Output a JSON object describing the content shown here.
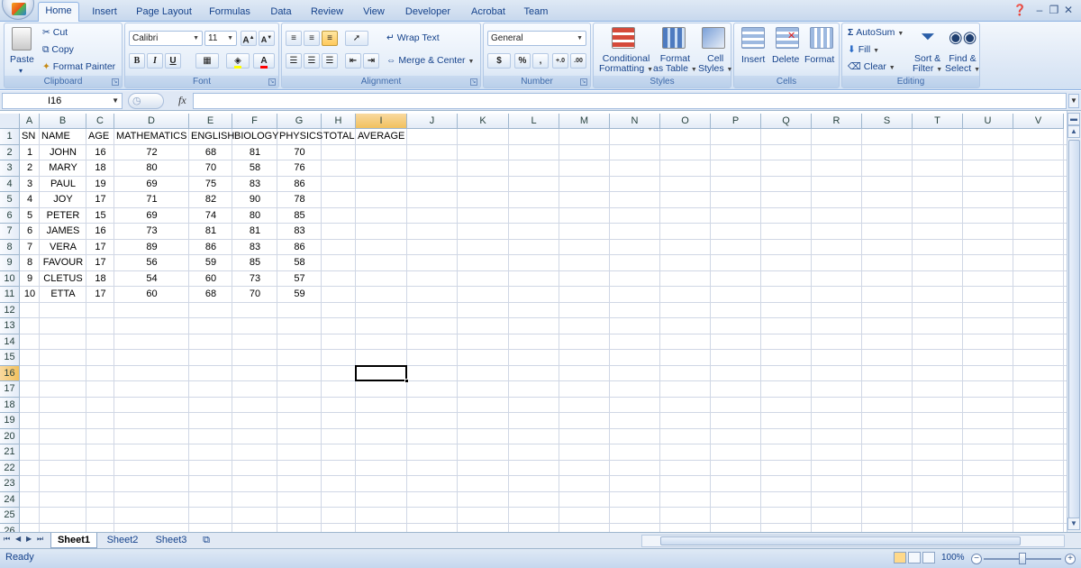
{
  "tabs": [
    "Home",
    "Insert",
    "Page Layout",
    "Formulas",
    "Data",
    "Review",
    "View",
    "Developer",
    "Acrobat",
    "Team"
  ],
  "active_tab": "Home",
  "ribbon": {
    "clipboard": {
      "label": "Clipboard",
      "paste": "Paste",
      "cut": "Cut",
      "copy": "Copy",
      "format_painter": "Format Painter"
    },
    "font": {
      "label": "Font",
      "font_name": "Calibri",
      "font_size": "11",
      "bold": "B",
      "italic": "I",
      "underline": "U"
    },
    "alignment": {
      "label": "Alignment",
      "wrap_text": "Wrap Text",
      "merge_center": "Merge & Center"
    },
    "number": {
      "label": "Number",
      "format": "General",
      "currency": "$",
      "percent": "%",
      "comma": ",",
      "inc_decimal": "+.0",
      "dec_decimal": ".00"
    },
    "styles": {
      "label": "Styles",
      "conditional_1": "Conditional",
      "conditional_2": "Formatting",
      "format_table_1": "Format",
      "format_table_2": "as Table",
      "cell_styles_1": "Cell",
      "cell_styles_2": "Styles"
    },
    "cells": {
      "label": "Cells",
      "insert": "Insert",
      "delete": "Delete",
      "format": "Format"
    },
    "editing": {
      "label": "Editing",
      "autosum": "AutoSum",
      "fill": "Fill",
      "clear": "Clear",
      "sort_1": "Sort &",
      "sort_2": "Filter",
      "find_1": "Find &",
      "find_2": "Select"
    }
  },
  "formula_bar": {
    "name_box": "I16",
    "fx": "fx",
    "formula": ""
  },
  "columns": [
    "A",
    "B",
    "C",
    "D",
    "E",
    "F",
    "G",
    "H",
    "I",
    "J",
    "K",
    "L",
    "M",
    "N",
    "O",
    "P",
    "Q",
    "R",
    "S",
    "T",
    "U",
    "V"
  ],
  "selected_column": "I",
  "rows": [
    "1",
    "2",
    "3",
    "4",
    "5",
    "6",
    "7",
    "8",
    "9",
    "10",
    "11",
    "12",
    "13",
    "14",
    "15",
    "16",
    "17",
    "18",
    "19",
    "20",
    "21",
    "22",
    "23",
    "24",
    "25",
    "26"
  ],
  "selected_row": "16",
  "sheet": {
    "headers": [
      "SN",
      "NAME",
      "AGE",
      "MATHEMATICS",
      "ENGLISH",
      "BIOLOGY",
      "PHYSICS",
      "TOTAL",
      "AVERAGE"
    ],
    "data": [
      [
        "1",
        "JOHN",
        "16",
        "72",
        "68",
        "81",
        "70"
      ],
      [
        "2",
        "MARY",
        "18",
        "80",
        "70",
        "58",
        "76"
      ],
      [
        "3",
        "PAUL",
        "19",
        "69",
        "75",
        "83",
        "86"
      ],
      [
        "4",
        "JOY",
        "17",
        "71",
        "82",
        "90",
        "78"
      ],
      [
        "5",
        "PETER",
        "15",
        "69",
        "74",
        "80",
        "85"
      ],
      [
        "6",
        "JAMES",
        "16",
        "73",
        "81",
        "81",
        "83"
      ],
      [
        "7",
        "VERA",
        "17",
        "89",
        "86",
        "83",
        "86"
      ],
      [
        "8",
        "FAVOUR",
        "17",
        "56",
        "59",
        "85",
        "58"
      ],
      [
        "9",
        "CLETUS",
        "18",
        "54",
        "60",
        "73",
        "57"
      ],
      [
        "10",
        "ETTA",
        "17",
        "60",
        "68",
        "70",
        "59"
      ]
    ]
  },
  "sheet_tabs": [
    "Sheet1",
    "Sheet2",
    "Sheet3"
  ],
  "active_sheet": "Sheet1",
  "status": {
    "ready": "Ready",
    "zoom": "100%"
  }
}
